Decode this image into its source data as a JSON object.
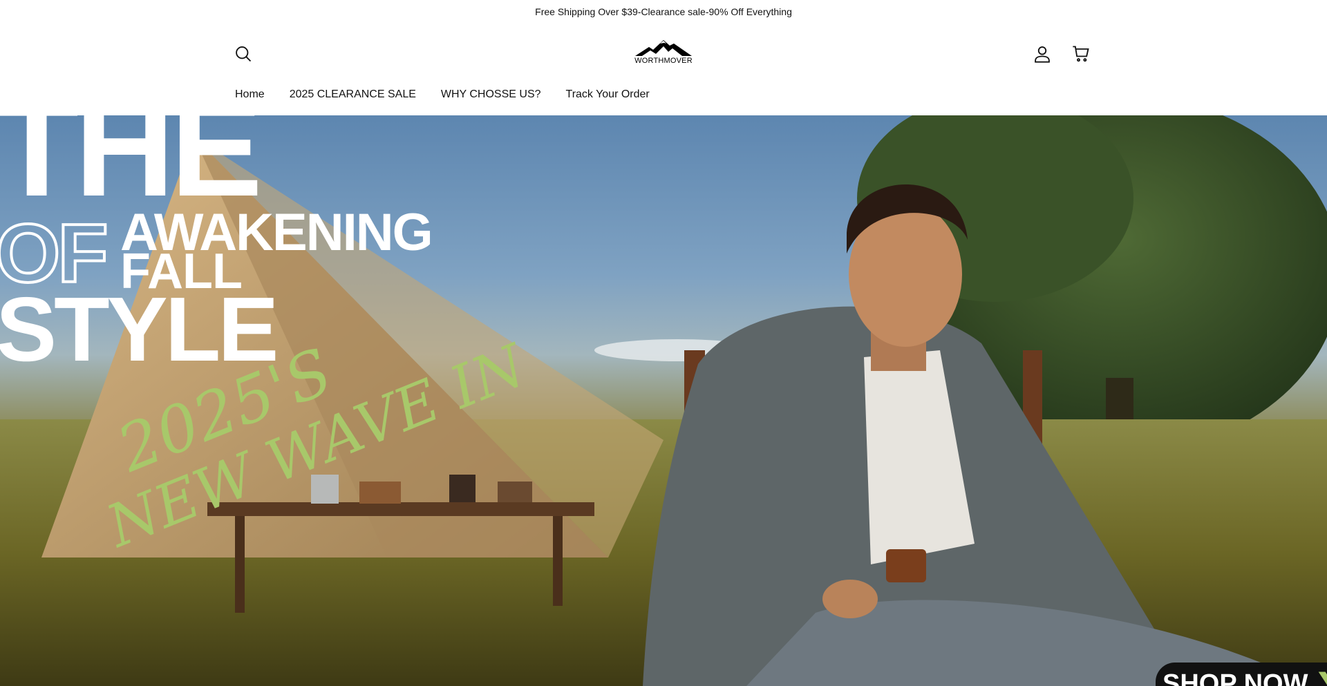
{
  "announcement": {
    "text": "Free Shipping Over $39-Clearance sale-90% Off Everything"
  },
  "header": {
    "logo_text": "WORTHMOVER",
    "icons": {
      "search": "search-icon",
      "account": "account-icon",
      "cart": "cart-icon"
    }
  },
  "nav": {
    "items": [
      {
        "label": "Home"
      },
      {
        "label": "2025 CLEARANCE SALE"
      },
      {
        "label": "WHY CHOSSE US?"
      },
      {
        "label": "Track Your Order"
      }
    ]
  },
  "hero": {
    "line_the": "THE",
    "line_of": "OF",
    "line_awakening": "AWAKENING",
    "line_fall": "FALL",
    "line_style": "STYLE",
    "script_line1": "2025'S",
    "script_line2": "NEW WAVE IN",
    "cta_label": "SHOP NOW",
    "cta_arrow": "❯",
    "colors": {
      "script_green": "#a8c86a",
      "cta_background": "#111111"
    }
  }
}
